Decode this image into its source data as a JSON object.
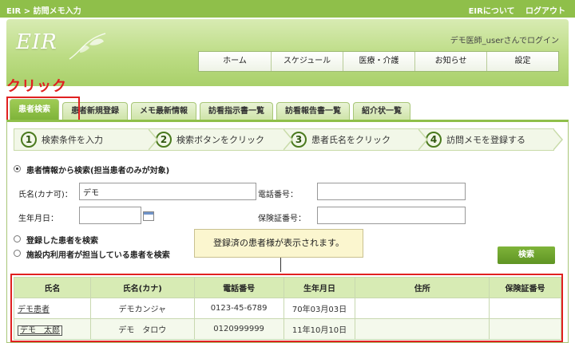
{
  "topbar": {
    "breadcrumb": "EIR > 訪問メモ入力",
    "about": "EIRについて",
    "logout": "ログアウト"
  },
  "header": {
    "logo": "EIR",
    "login_user": "デモ医師_userさんでログイン",
    "nav": [
      "ホーム",
      "スケジュール",
      "医療・介護",
      "お知らせ",
      "設定"
    ]
  },
  "annotation": {
    "click": "クリック"
  },
  "tabs": [
    "患者検索",
    "患者新規登録",
    "メモ最新情報",
    "訪看指示書一覧",
    "訪看報告書一覧",
    "紹介状一覧"
  ],
  "steps": [
    {
      "num": "1",
      "label": "検索条件を入力"
    },
    {
      "num": "2",
      "label": "検索ボタンをクリック"
    },
    {
      "num": "3",
      "label": "患者氏名をクリック"
    },
    {
      "num": "4",
      "label": "訪問メモを登録する"
    }
  ],
  "form": {
    "radio_main": "患者情報から検索(担当患者のみが対象)",
    "name_label": "氏名(カナ可)：",
    "name_value": "デモ",
    "phone_label": "電話番号：",
    "birth_label": "生年月日：",
    "insurance_label": "保険証番号：",
    "radio_registered": "登録した患者を検索",
    "radio_facility": "施設内利用者が担当している患者を検索",
    "search_button": "検索"
  },
  "tooltip": "登録済の患者様が表示されます。",
  "results": {
    "headers": [
      "氏名",
      "氏名(カナ)",
      "電話番号",
      "生年月日",
      "住所",
      "保険証番号"
    ],
    "rows": [
      [
        "デモ患者",
        "デモカンジャ",
        "0123-45-6789",
        "70年03月03日",
        "",
        ""
      ],
      [
        "デモ　太郎",
        "デモ　タロウ",
        "0120999999",
        "11年10月10日",
        "",
        ""
      ]
    ]
  },
  "colors": {
    "accent_green": "#8fbf4a",
    "highlight_red": "#e02020",
    "tooltip_bg": "#fbf6cf"
  }
}
